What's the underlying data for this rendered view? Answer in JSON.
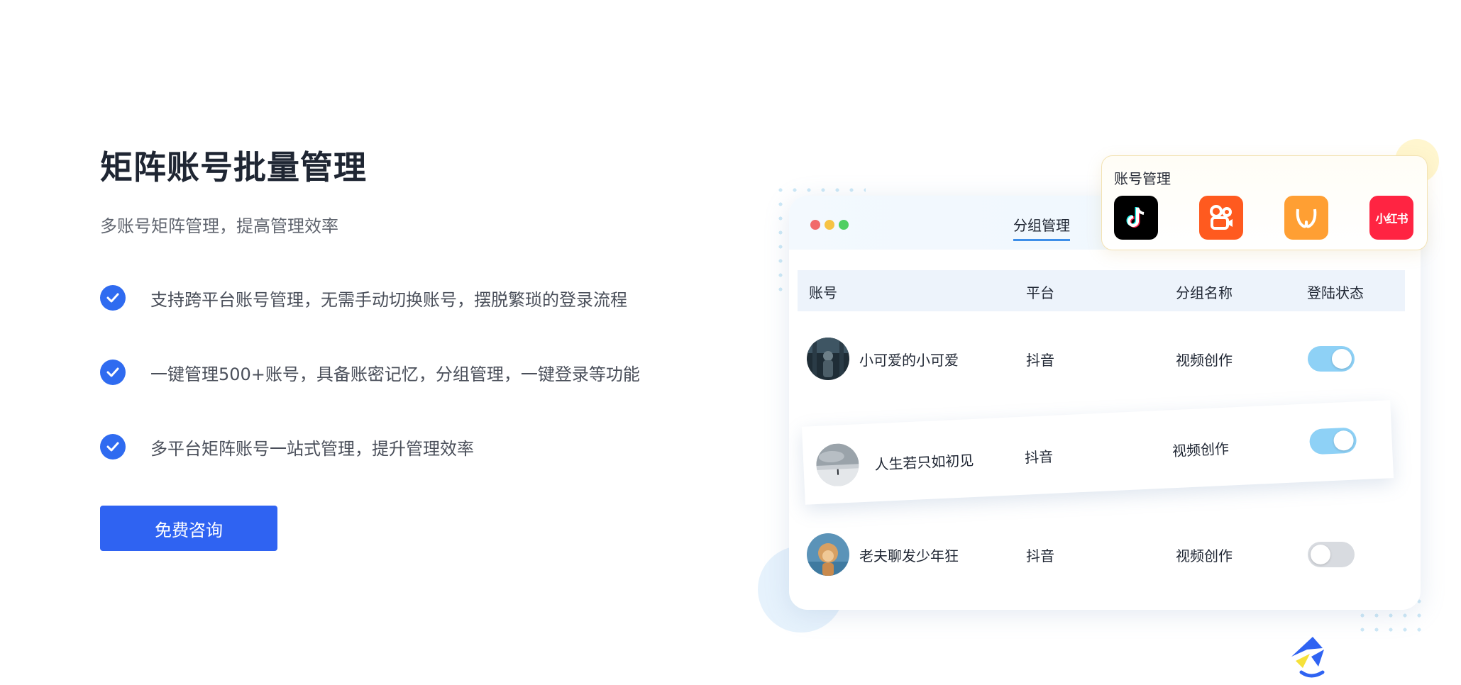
{
  "hero": {
    "title": "矩阵账号批量管理",
    "subtitle": "多账号矩阵管理，提高管理效率",
    "features": [
      "支持跨平台账号管理，无需手动切换账号，摆脱繁琐的登录流程",
      "一键管理500+账号，具备账密记忆，分组管理，一键登录等功能",
      "多平台矩阵账号一站式管理，提升管理效率"
    ],
    "cta_label": "免费咨询"
  },
  "card": {
    "window_lights": [
      "#f16b6b",
      "#f6c344",
      "#4fcf62"
    ],
    "tab_label": "分组管理",
    "columns": [
      "账号",
      "平台",
      "分组名称",
      "登陆状态"
    ],
    "rows": [
      {
        "name": "小可爱的小可爱",
        "platform": "抖音",
        "group": "视频创作",
        "logged_in": true
      },
      {
        "name": "人生若只如初见",
        "platform": "抖音",
        "group": "视频创作",
        "logged_in": true
      },
      {
        "name": "老夫聊发少年狂",
        "platform": "抖音",
        "group": "视频创作",
        "logged_in": false
      }
    ]
  },
  "popup": {
    "title": "账号管理",
    "apps": [
      {
        "icon": "douyin-icon",
        "color": "#000000"
      },
      {
        "icon": "kuaishou-icon",
        "color": "#ff5a1f"
      },
      {
        "icon": "kuaidian-icon",
        "color": "#ff9f33"
      },
      {
        "icon": "xiaohongshu-icon",
        "color": "#ff2442",
        "label": "小红书"
      }
    ]
  },
  "colors": {
    "accent": "#2f63f2",
    "toggle_on": "#8ed1f6",
    "toggle_off": "#d8dbe0"
  }
}
